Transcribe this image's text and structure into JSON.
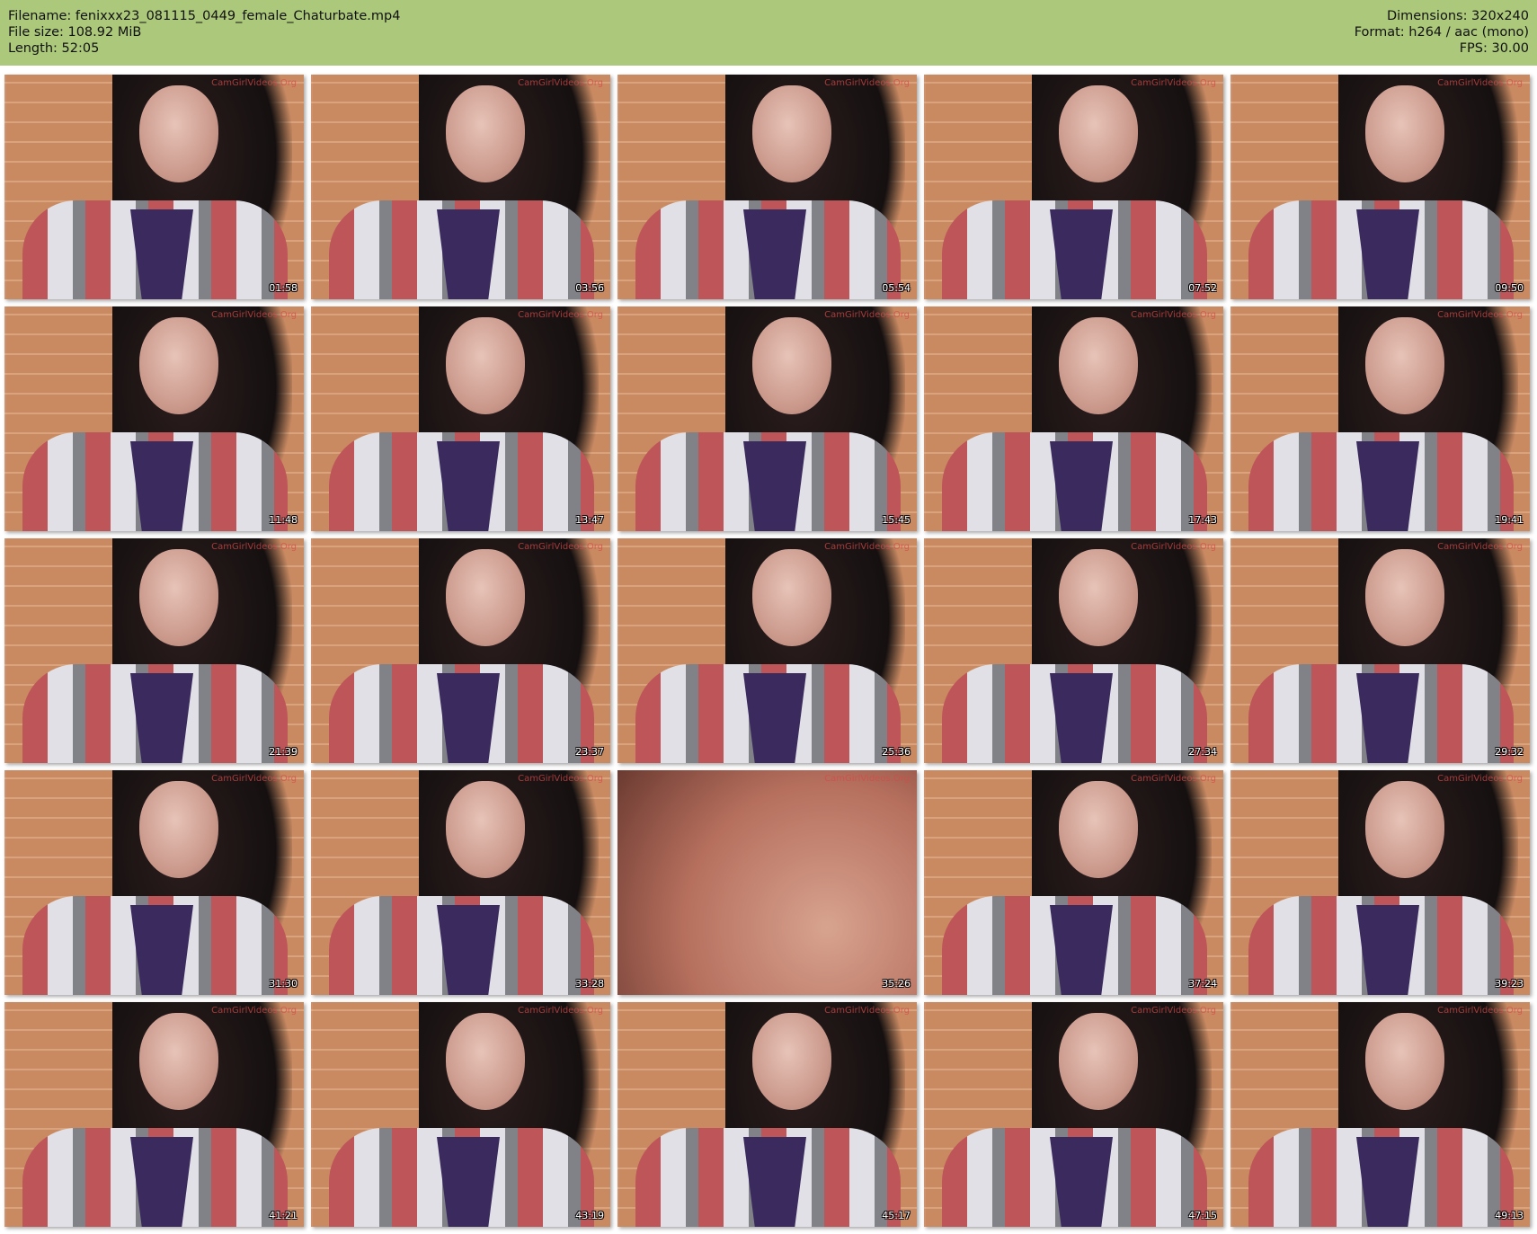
{
  "header": {
    "filename": "Filename: fenixxx23_081115_0449_female_Chaturbate.mp4",
    "filesize": "File size: 108.92 MiB",
    "length": "Length: 52:05",
    "dimensions": "Dimensions: 320x240",
    "format": "Format: h264 / aac (mono)",
    "fps": "FPS: 30.00"
  },
  "thumbnails": [
    {
      "time": "01:58"
    },
    {
      "time": "03:56"
    },
    {
      "time": "05:54"
    },
    {
      "time": "07:52"
    },
    {
      "time": "09:50"
    },
    {
      "time": "11:48"
    },
    {
      "time": "13:47"
    },
    {
      "time": "15:45"
    },
    {
      "time": "17:43"
    },
    {
      "time": "19:41"
    },
    {
      "time": "21:39"
    },
    {
      "time": "23:37"
    },
    {
      "time": "25:36"
    },
    {
      "time": "27:34"
    },
    {
      "time": "29:32"
    },
    {
      "time": "31:30"
    },
    {
      "time": "33:28"
    },
    {
      "time": "35:26"
    },
    {
      "time": "37:24"
    },
    {
      "time": "39:23"
    },
    {
      "time": "41:21"
    },
    {
      "time": "43:19"
    },
    {
      "time": "45:17"
    },
    {
      "time": "47:15"
    },
    {
      "time": "49:13"
    }
  ],
  "watermark": "CamGirlVideos.Org",
  "colors": {
    "header_bg": "#acc97b"
  }
}
